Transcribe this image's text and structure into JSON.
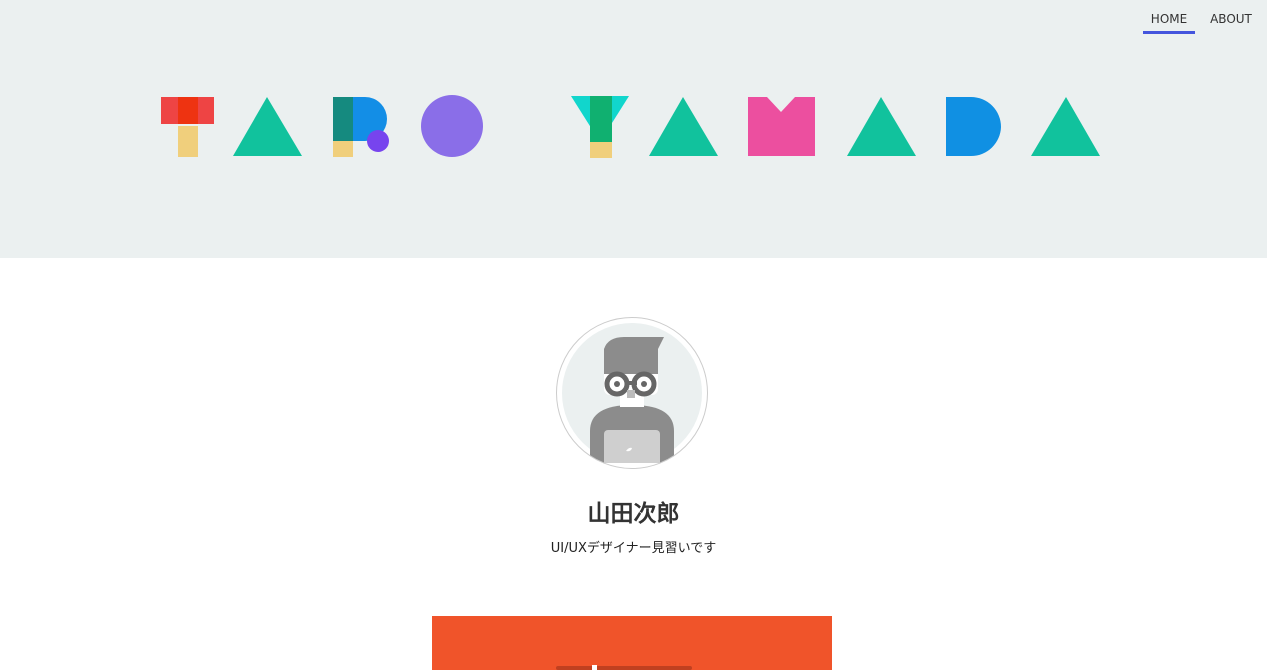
{
  "nav": {
    "items": [
      {
        "label": "HOME",
        "active": true
      },
      {
        "label": "ABOUT",
        "active": false
      }
    ],
    "active_color": "#4455dd"
  },
  "logo": {
    "letters": [
      "T",
      "A",
      "R",
      "O",
      "Y",
      "A",
      "M",
      "A",
      "D",
      "A"
    ]
  },
  "profile": {
    "name": "山田次郎",
    "tagline": "UI/UXデザイナー見習いです"
  },
  "colors": {
    "hero_background": "#ebf0f0",
    "card_background": "#f0542a"
  }
}
